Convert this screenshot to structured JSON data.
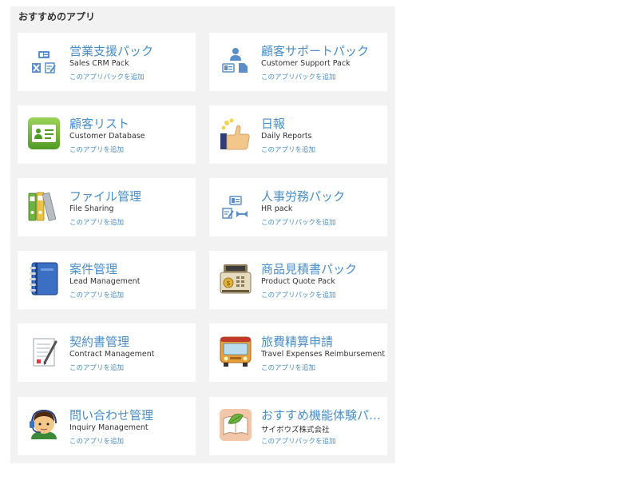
{
  "section": {
    "title": "おすすめのアプリ"
  },
  "cards": [
    {
      "title": "営業支援パック",
      "subtitle": "Sales CRM Pack",
      "link": "このアプリパックを追加",
      "icon": "sales-pack-icon"
    },
    {
      "title": "顧客サポートパック",
      "subtitle": "Customer Support Pack",
      "link": "このアプリパックを追加",
      "icon": "support-pack-icon"
    },
    {
      "title": "顧客リスト",
      "subtitle": "Customer Database",
      "link": "このアプリを追加",
      "icon": "contact-card-icon"
    },
    {
      "title": "日報",
      "subtitle": "Daily Reports",
      "link": "このアプリを追加",
      "icon": "thumbs-up-icon"
    },
    {
      "title": "ファイル管理",
      "subtitle": "File Sharing",
      "link": "このアプリを追加",
      "icon": "binders-icon"
    },
    {
      "title": "人事労務パック",
      "subtitle": "HR pack",
      "link": "このアプリパックを追加",
      "icon": "hr-pack-icon"
    },
    {
      "title": "案件管理",
      "subtitle": "Lead Management",
      "link": "このアプリを追加",
      "icon": "notebook-icon"
    },
    {
      "title": "商品見積書パック",
      "subtitle": "Product Quote Pack",
      "link": "このアプリパックを追加",
      "icon": "cash-register-icon"
    },
    {
      "title": "契約書管理",
      "subtitle": "Contract Management",
      "link": "このアプリを追加",
      "icon": "contract-pen-icon"
    },
    {
      "title": "旅費精算申請",
      "subtitle": "Travel Expenses Reimbursement",
      "link": "このアプリを追加",
      "icon": "bus-icon"
    },
    {
      "title": "問い合わせ管理",
      "subtitle": "Inquiry Management",
      "link": "このアプリを追加",
      "icon": "headset-agent-icon"
    },
    {
      "title": "おすすめ機能体験パック",
      "subtitle": "サイボウズ株式会社",
      "link": "このアプリパックを追加",
      "icon": "book-leaf-icon"
    }
  ]
}
